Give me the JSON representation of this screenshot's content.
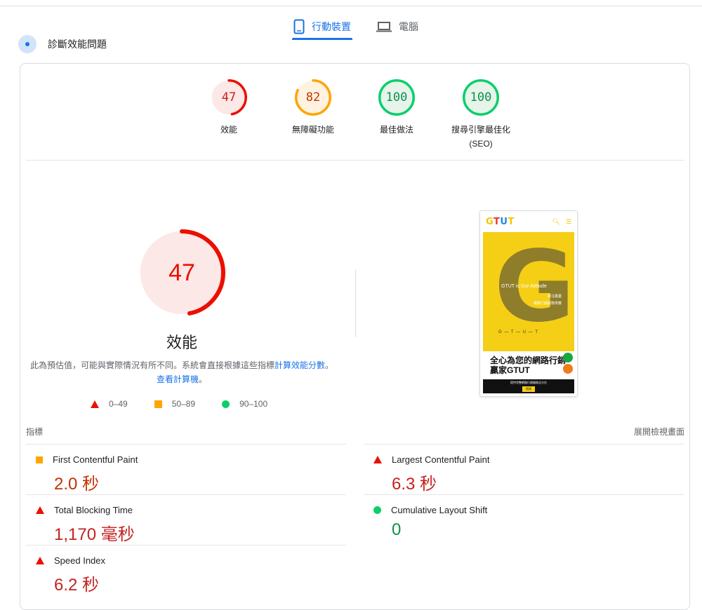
{
  "tabs": {
    "mobile_label": "行動裝置",
    "desktop_label": "電腦"
  },
  "diagnosis": {
    "title": "診斷效能問題"
  },
  "gauges": [
    {
      "score": "47",
      "label": "效能",
      "value": 47,
      "color": "#eb0f00",
      "bg": "#fce8e6"
    },
    {
      "score": "82",
      "label": "無障礙功能",
      "value": 82,
      "color": "#ffa400",
      "bg": "#fff3e0"
    },
    {
      "score": "100",
      "label": "最佳做法",
      "value": 100,
      "color": "#0cce6b",
      "bg": "#e6f4ea"
    },
    {
      "score": "100",
      "label": "搜尋引擎最佳化",
      "label2": "(SEO)",
      "value": 100,
      "color": "#0cce6b",
      "bg": "#e6f4ea"
    }
  ],
  "performance": {
    "score": "47",
    "value": 47,
    "title": "效能",
    "note_prefix": "此為預估值，可能與實際情況有所不同。系統會直接根據這些指標",
    "note_link1": "計算效能分數",
    "note_mid": "。",
    "note_link2": "查看計算機",
    "note_suffix": "。"
  },
  "legend": {
    "red": "0–49",
    "orange": "50–89",
    "green": "90–100"
  },
  "screenshot": {
    "logo": "GTUT",
    "hero_tag": "GTUT is Our Attitude",
    "hero_line2": "專注專業",
    "hero_line3": "網路行銷服務供應",
    "hero_bottom": "G — T — U — T",
    "headline": "全心為您的網路行銷贏家GTUT",
    "footer_text": "提供完整網路行銷服務全方位",
    "footer_button": "閱讀"
  },
  "metrics": {
    "header": "指標",
    "expand_label": "展開檢視畫面",
    "items": [
      {
        "name": "First Contentful Paint",
        "value": "2.0 秒",
        "status": "orange"
      },
      {
        "name": "Largest Contentful Paint",
        "value": "6.3 秒",
        "status": "red"
      },
      {
        "name": "Total Blocking Time",
        "value": "1,170 毫秒",
        "status": "red"
      },
      {
        "name": "Cumulative Layout Shift",
        "value": "0",
        "status": "green"
      },
      {
        "name": "Speed Index",
        "value": "6.2 秒",
        "status": "red"
      }
    ]
  }
}
